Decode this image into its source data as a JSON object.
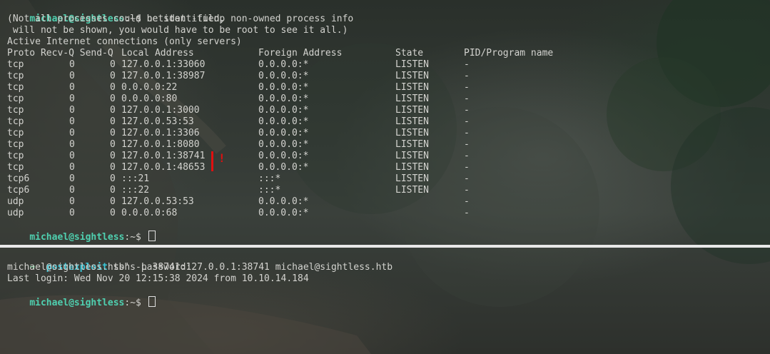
{
  "top_pane": {
    "prompt1": {
      "user": "michael@sightless",
      "suffix": ":~$ ",
      "command": "netstat -tulnp"
    },
    "info_lines": [
      "(Not all processes could be identified, non-owned process info",
      " will not be shown, you would have to be root to see it all.)",
      "Active Internet connections (only servers)"
    ],
    "headers": {
      "proto_recv_send": "Proto Recv-Q Send-Q",
      "local": "Local Address",
      "foreign": "Foreign Address",
      "state": "State",
      "pid": "PID/Program name"
    },
    "rows": [
      {
        "proto": "tcp",
        "recv": "0",
        "send": "0",
        "local": "127.0.0.1:33060",
        "foreign": "0.0.0.0:*",
        "state": "LISTEN",
        "pid": "-"
      },
      {
        "proto": "tcp",
        "recv": "0",
        "send": "0",
        "local": "127.0.0.1:38987",
        "foreign": "0.0.0.0:*",
        "state": "LISTEN",
        "pid": "-"
      },
      {
        "proto": "tcp",
        "recv": "0",
        "send": "0",
        "local": "0.0.0.0:22",
        "foreign": "0.0.0.0:*",
        "state": "LISTEN",
        "pid": "-"
      },
      {
        "proto": "tcp",
        "recv": "0",
        "send": "0",
        "local": "0.0.0.0:80",
        "foreign": "0.0.0.0:*",
        "state": "LISTEN",
        "pid": "-"
      },
      {
        "proto": "tcp",
        "recv": "0",
        "send": "0",
        "local": "127.0.0.1:3000",
        "foreign": "0.0.0.0:*",
        "state": "LISTEN",
        "pid": "-"
      },
      {
        "proto": "tcp",
        "recv": "0",
        "send": "0",
        "local": "127.0.0.53:53",
        "foreign": "0.0.0.0:*",
        "state": "LISTEN",
        "pid": "-"
      },
      {
        "proto": "tcp",
        "recv": "0",
        "send": "0",
        "local": "127.0.0.1:3306",
        "foreign": "0.0.0.0:*",
        "state": "LISTEN",
        "pid": "-"
      },
      {
        "proto": "tcp",
        "recv": "0",
        "send": "0",
        "local": "127.0.0.1:8080",
        "foreign": "0.0.0.0:*",
        "state": "LISTEN",
        "pid": "-"
      },
      {
        "proto": "tcp",
        "recv": "0",
        "send": "0",
        "local": "127.0.0.1:38741",
        "foreign": "0.0.0.0:*",
        "state": "LISTEN",
        "pid": "-"
      },
      {
        "proto": "tcp",
        "recv": "0",
        "send": "0",
        "local": "127.0.0.1:48653",
        "foreign": "0.0.0.0:*",
        "state": "LISTEN",
        "pid": "-"
      },
      {
        "proto": "tcp6",
        "recv": "0",
        "send": "0",
        "local": ":::21",
        "foreign": ":::*",
        "state": "LISTEN",
        "pid": "-"
      },
      {
        "proto": "tcp6",
        "recv": "0",
        "send": "0",
        "local": ":::22",
        "foreign": ":::*",
        "state": "LISTEN",
        "pid": "-"
      },
      {
        "proto": "udp",
        "recv": "0",
        "send": "0",
        "local": "127.0.0.53:53",
        "foreign": "0.0.0.0:*",
        "state": "",
        "pid": "-"
      },
      {
        "proto": "udp",
        "recv": "0",
        "send": "0",
        "local": "0.0.0.0:68",
        "foreign": "0.0.0.0:*",
        "state": "",
        "pid": "-"
      }
    ],
    "prompt2": {
      "user": "michael@sightless",
      "suffix": ":~$ "
    },
    "annotation_mark": "!"
  },
  "bottom_pane": {
    "zsh_prompt": {
      "arrow": "➜",
      "dir": "postexploit",
      "command": "ssh -L 38741:127.0.0.1:38741 michael@sightless.htb"
    },
    "output_lines": [
      "michael@sightless.htb's password:",
      "Last login: Wed Nov 20 12:15:38 2024 from 10.10.14.184"
    ],
    "prompt": {
      "user": "michael@sightless",
      "suffix": ":~$ "
    }
  },
  "colors": {
    "prompt_user": "#4fd0b0",
    "zsh_arrow": "#3fd07a",
    "zsh_dir": "#38c7d8",
    "annotation": "#e01010",
    "divider": "#e8e8e8"
  }
}
